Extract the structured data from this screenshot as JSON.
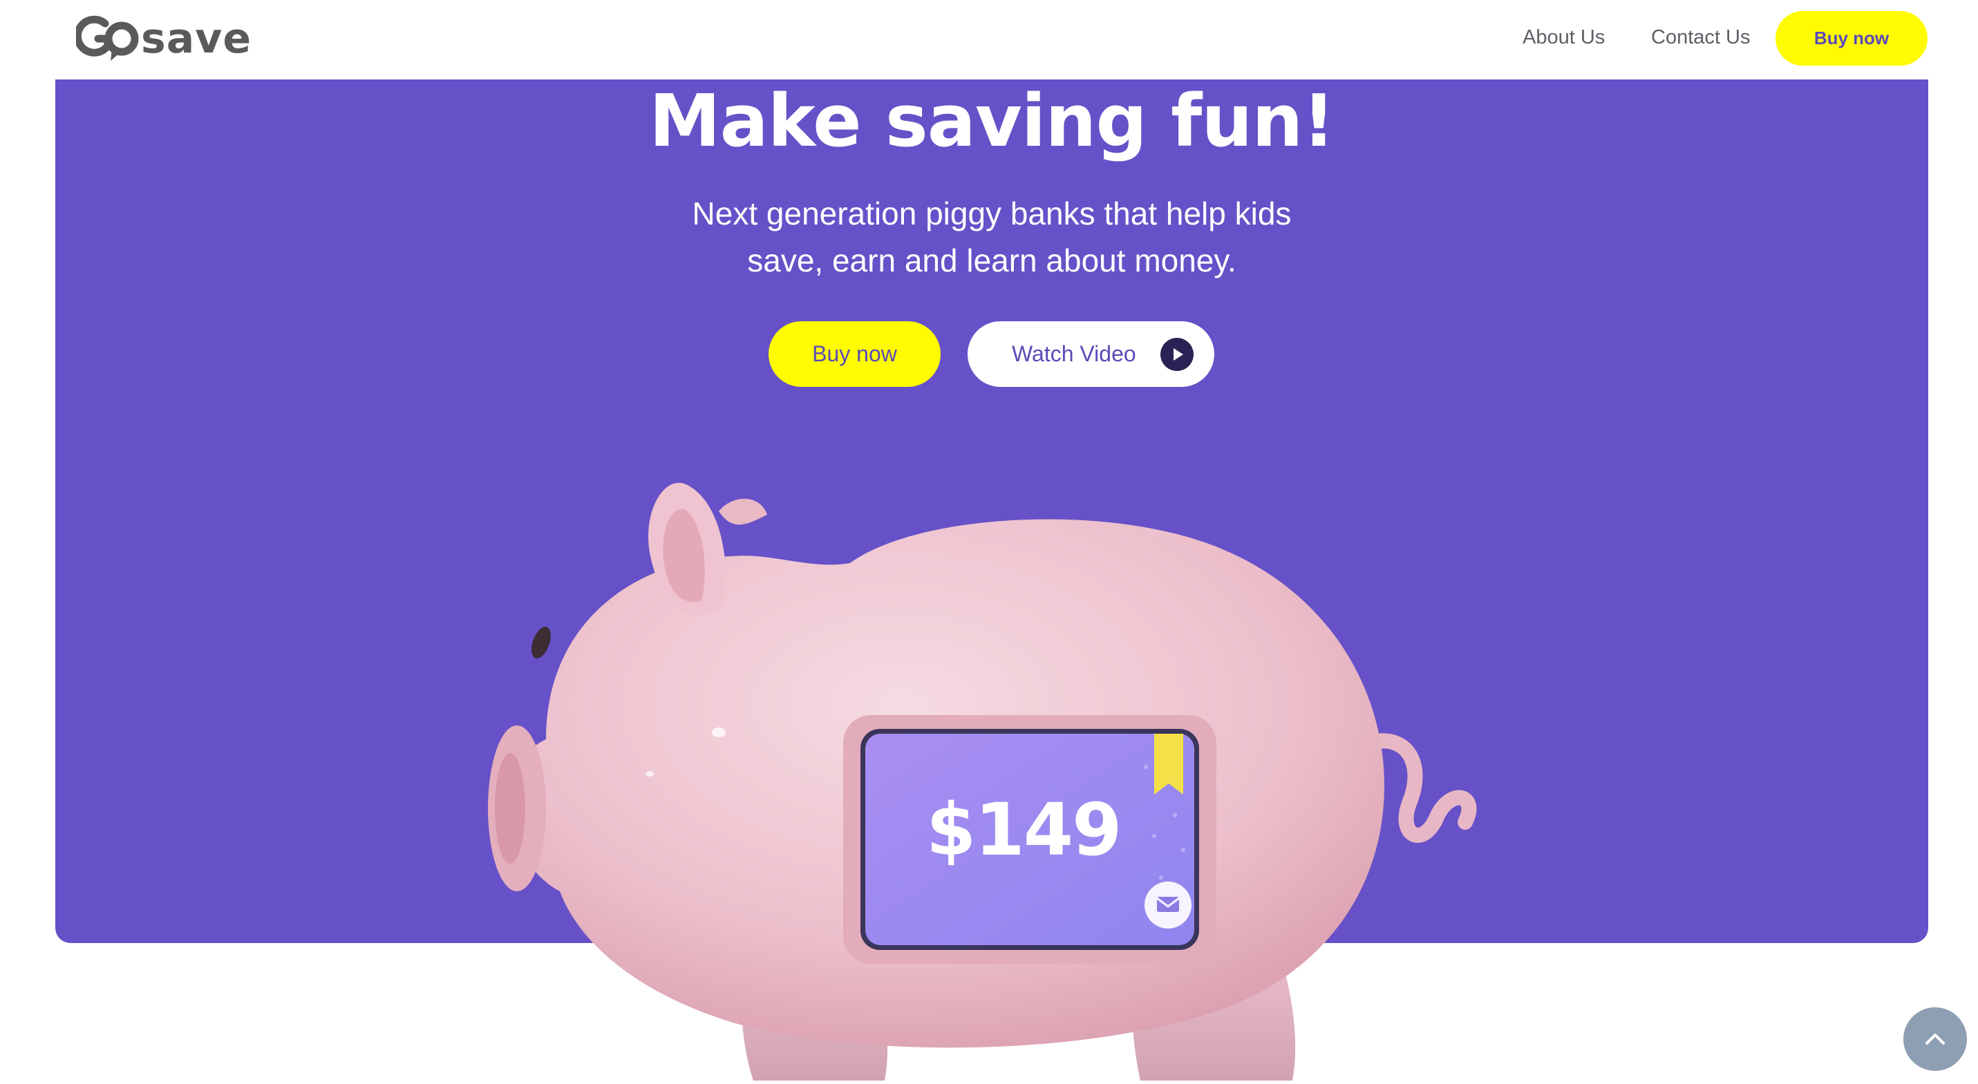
{
  "header": {
    "logo_text": "save",
    "nav": {
      "about": "About Us",
      "contact": "Contact Us",
      "buy": "Buy now"
    }
  },
  "hero": {
    "title": "Make saving fun!",
    "subtitle_line1": "Next generation piggy banks that help kids",
    "subtitle_line2": "save, earn and learn about money.",
    "buy_label": "Buy now",
    "watch_label": "Watch Video"
  },
  "pig_screen": {
    "amount": "$149"
  },
  "colors": {
    "brand_purple": "#6751c8",
    "accent_yellow": "#fffb00",
    "pig_pink": "#efc3cf",
    "screen_purple": "#9a82ef"
  },
  "icons": {
    "play": "play-icon",
    "chevron_up": "chevron-up-icon",
    "mail": "mail-icon"
  }
}
